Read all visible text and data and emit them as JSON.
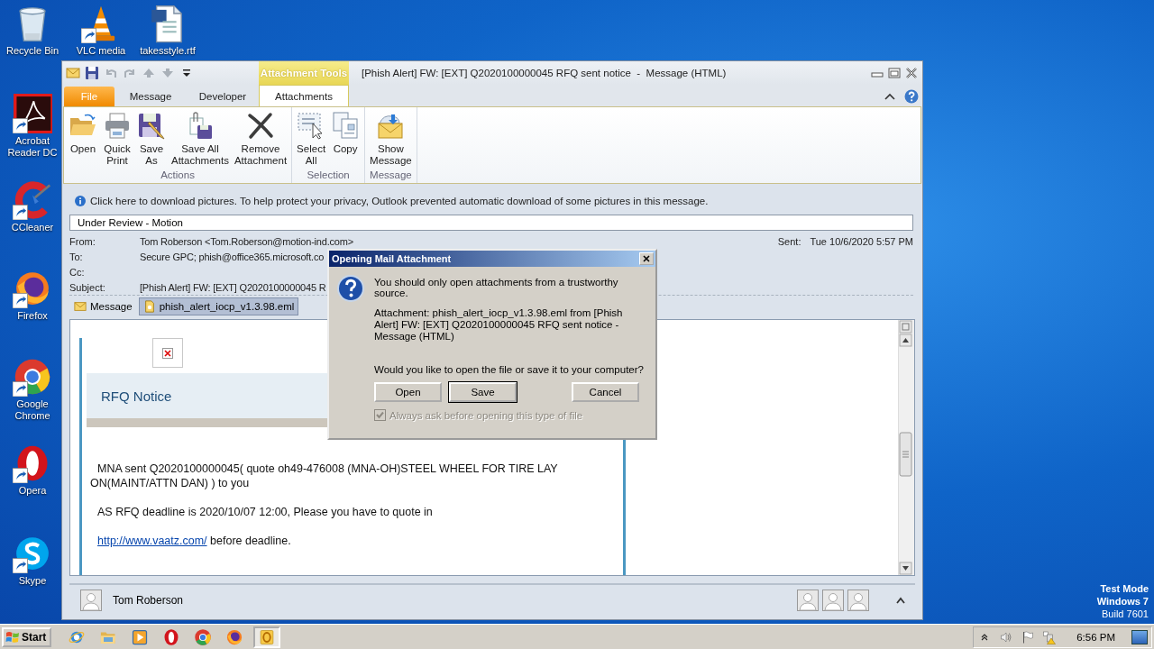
{
  "desktop": {
    "icons": [
      {
        "label": "Recycle Bin",
        "kind": "recycle-bin",
        "shortcut": false
      },
      {
        "label": "VLC media",
        "kind": "cone",
        "shortcut": true
      },
      {
        "label": "takesstyle.rtf",
        "kind": "document",
        "shortcut": false
      },
      {
        "label": "Acrobat Reader DC",
        "kind": "acrobat",
        "shortcut": true
      },
      {
        "label": "CCleaner",
        "kind": "ccleaner",
        "shortcut": true
      },
      {
        "label": "Firefox",
        "kind": "firefox",
        "shortcut": true
      },
      {
        "label": "Google Chrome",
        "kind": "chrome",
        "shortcut": true
      },
      {
        "label": "Opera",
        "kind": "opera",
        "shortcut": true
      },
      {
        "label": "Skype",
        "kind": "skype",
        "shortcut": true
      }
    ],
    "test_mode": [
      "Test Mode",
      "Windows 7",
      "Build 7601"
    ]
  },
  "window": {
    "title": "[Phish Alert] FW: [EXT] Q2020100000045 RFQ sent notice  -  Message (HTML)",
    "context_tab": "Attachment Tools",
    "tabs": [
      {
        "label": "File",
        "kind": "file",
        "selected": false
      },
      {
        "label": "Message",
        "kind": "plain",
        "selected": false
      },
      {
        "label": "Developer",
        "kind": "plain",
        "selected": false
      },
      {
        "label": "Attachments",
        "kind": "plain",
        "selected": true
      }
    ],
    "ribbon_groups": [
      {
        "label": "Actions",
        "buttons": [
          {
            "lines": [
              "Open"
            ],
            "kind": "open"
          },
          {
            "lines": [
              "Quick",
              "Print"
            ],
            "kind": "print"
          },
          {
            "lines": [
              "Save",
              "As"
            ],
            "kind": "save-as"
          },
          {
            "lines": [
              "Save All",
              "Attachments"
            ],
            "kind": "save-all"
          },
          {
            "lines": [
              "Remove",
              "Attachment"
            ],
            "kind": "remove"
          }
        ]
      },
      {
        "label": "Selection",
        "buttons": [
          {
            "lines": [
              "Select",
              "All"
            ],
            "kind": "select-all"
          },
          {
            "lines": [
              "Copy"
            ],
            "kind": "copy"
          }
        ]
      },
      {
        "label": "Message",
        "buttons": [
          {
            "lines": [
              "Show",
              "Message"
            ],
            "kind": "show-message"
          }
        ]
      }
    ],
    "info_bar": "Click here to download pictures. To help protect your privacy, Outlook prevented automatic download of some pictures in this message.",
    "flag_text": "Under Review - Motion",
    "headers": [
      {
        "label": "From:",
        "value": "Tom Roberson <Tom.Roberson@motion-ind.com>"
      },
      {
        "label": "To:",
        "value": "Secure GPC; phish@office365.microsoft.co"
      },
      {
        "label": "Cc:"
      },
      {
        "label": "Subject:",
        "value": "[Phish Alert] FW: [EXT] Q2020100000045 R"
      }
    ],
    "sent": {
      "label": "Sent:",
      "value": "Tue 10/6/2020 5:57 PM"
    },
    "attachments": [
      {
        "label": "Message",
        "kind": "message",
        "selected": false
      },
      {
        "label": "phish_alert_iocp_v1.3.98.eml",
        "kind": "file",
        "selected": true
      }
    ],
    "body": {
      "banner": "RFQ Notice",
      "paragraphs": [
        "MNA sent Q2020100000045( quote oh49-476008 (MNA-OH)STEEL WHEEL FOR TIRE LAY ON(MAINT/ATTN DAN) ) to you",
        "AS RFQ deadline is 2020/10/07 12:00, Please you have to quote in"
      ],
      "link": "http://www.vaatz.com/",
      "link_suffix": " before deadline."
    },
    "people": {
      "name": "Tom Roberson"
    }
  },
  "dialog": {
    "title": "Opening Mail Attachment",
    "warning": "You should only open attachments from a trustworthy source.",
    "details": "Attachment: phish_alert_iocp_v1.3.98.eml from [Phish Alert] FW: [EXT] Q2020100000045 RFQ sent notice - Message (HTML)",
    "question": "Would you like to open the file or save it to your computer?",
    "buttons": [
      {
        "label": "Open",
        "default": false
      },
      {
        "label": "Save",
        "default": true
      },
      {
        "label": "Cancel",
        "default": false
      }
    ],
    "checkbox": {
      "label": "Always ask before opening this type of file",
      "checked": true,
      "disabled": true
    }
  },
  "taskbar": {
    "start": "Start",
    "apps": [
      {
        "kind": "ie",
        "active": false
      },
      {
        "kind": "explorer",
        "active": false
      },
      {
        "kind": "media",
        "active": false
      },
      {
        "kind": "opera",
        "active": false
      },
      {
        "kind": "chrome",
        "active": false
      },
      {
        "kind": "firefox",
        "active": false
      },
      {
        "kind": "outlook",
        "active": true
      }
    ],
    "tray": [
      {
        "kind": "chevron"
      },
      {
        "kind": "speaker"
      },
      {
        "kind": "flag"
      },
      {
        "kind": "network"
      }
    ],
    "time": "6:56 PM"
  }
}
